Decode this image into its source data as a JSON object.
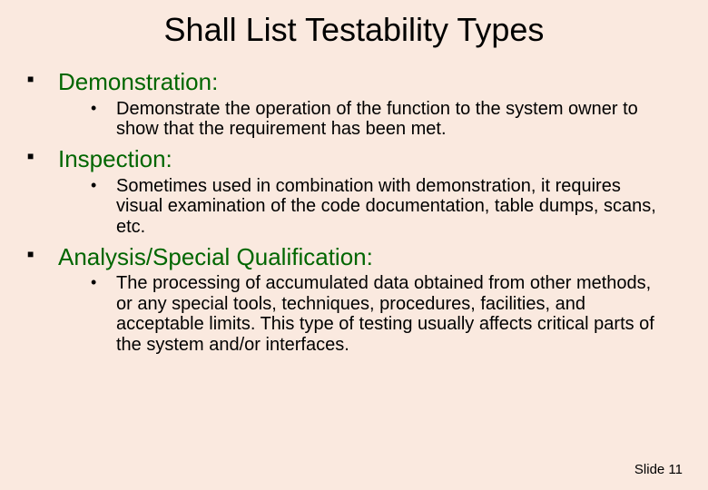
{
  "title": "Shall List Testability Types",
  "sections": [
    {
      "heading": "Demonstration:",
      "body": "Demonstrate the operation of the function to the system owner to show that the requirement has been met."
    },
    {
      "heading": "Inspection:",
      "body": "Sometimes used in combination with demonstration, it requires visual examination of the code documentation, table dumps, scans, etc."
    },
    {
      "heading": "Analysis/Special Qualification:",
      "body": "The processing of accumulated data obtained from other methods, or any special tools, techniques, procedures, facilities, and acceptable limits. This type of testing usually affects critical parts of the system and/or interfaces."
    }
  ],
  "footer": "Slide  11"
}
